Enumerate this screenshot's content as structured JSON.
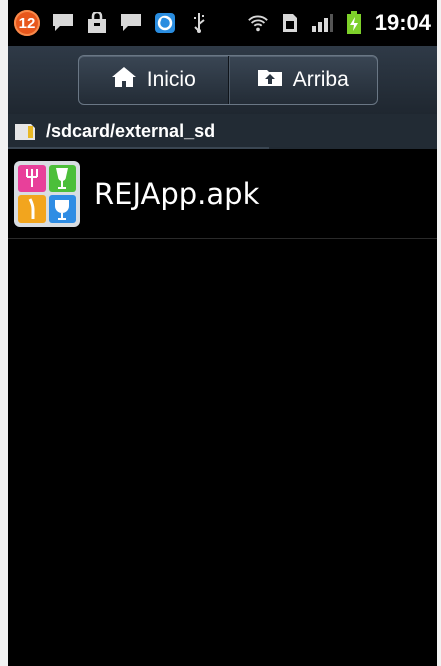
{
  "status_bar": {
    "notification_count": "12",
    "time": "19:04",
    "icons": [
      "chat-icon",
      "shopping-bag-icon",
      "chat-icon",
      "skype-icon",
      "usb-icon",
      "wifi-icon",
      "sim-icon",
      "signal-icon",
      "battery-charging-icon"
    ]
  },
  "toolbar": {
    "home_label": "Inicio",
    "up_label": "Arriba"
  },
  "path_bar": {
    "path": "/sdcard/external_sd"
  },
  "files": [
    {
      "name": "REJApp.apk",
      "icon": "apk-app-icon"
    }
  ],
  "colors": {
    "background": "#000000",
    "toolbar": "#2a3440",
    "path_bar": "#222b34",
    "badge": "#e8571c",
    "battery": "#7dd02a"
  }
}
